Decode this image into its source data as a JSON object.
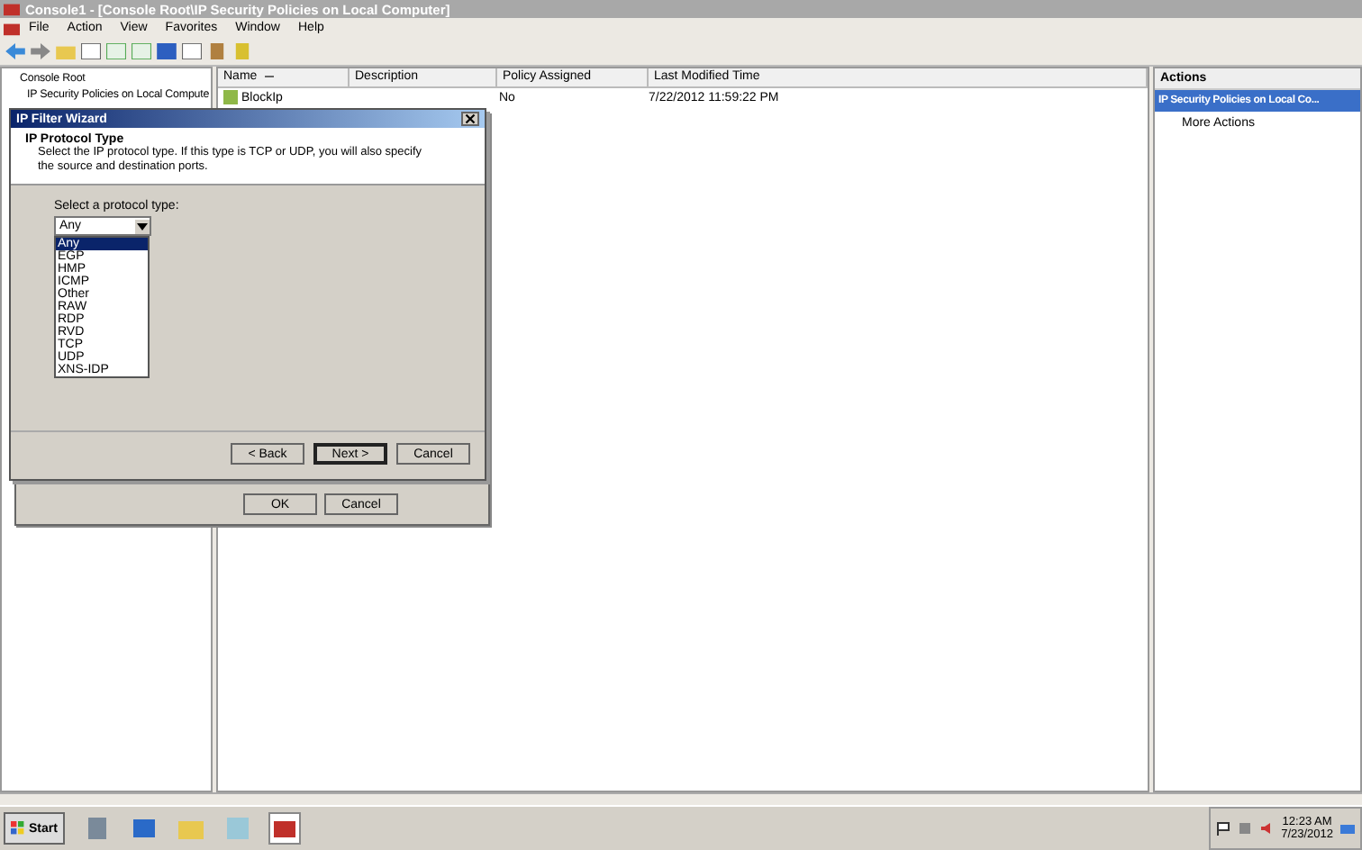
{
  "window": {
    "title": "Console1 - [Console Root\\IP Security Policies on Local Computer]"
  },
  "menu": [
    "File",
    "Action",
    "View",
    "Favorites",
    "Window",
    "Help"
  ],
  "tree": {
    "items": [
      {
        "label": "Console Root",
        "children": [
          {
            "label": "IP Security Policies on Local Compute"
          }
        ]
      }
    ]
  },
  "list": {
    "columns": [
      {
        "label": "Name",
        "sorted": true
      },
      {
        "label": "Description",
        "sorted": false
      },
      {
        "label": "Policy Assigned",
        "sorted": false
      },
      {
        "label": "Last Modified Time",
        "sorted": false
      }
    ],
    "rows": [
      {
        "name": "BlockIp",
        "policy_assigned": "No",
        "last_modified": "7/22/2012 11:59:22 PM"
      }
    ]
  },
  "actions": {
    "title": "Actions",
    "section": "IP Security Policies on Local Co...",
    "items": [
      "More Actions"
    ]
  },
  "background_dialog": {
    "buttons": [
      "OK",
      "Cancel"
    ]
  },
  "wizard": {
    "title": "IP Filter Wizard",
    "heading": "IP Protocol Type",
    "description": "Select the IP protocol type. If this type is TCP or UDP, you will also specify the source and destination ports.",
    "field_label": "Select a protocol type:",
    "combo_value": "Any",
    "options": [
      {
        "label": "Any",
        "selected": true
      },
      {
        "label": "EGP",
        "selected": false
      },
      {
        "label": "HMP",
        "selected": false
      },
      {
        "label": "ICMP",
        "selected": false
      },
      {
        "label": "Other",
        "selected": false
      },
      {
        "label": "RAW",
        "selected": false
      },
      {
        "label": "RDP",
        "selected": false
      },
      {
        "label": "RVD",
        "selected": false
      },
      {
        "label": "TCP",
        "selected": false
      },
      {
        "label": "UDP",
        "selected": false
      },
      {
        "label": "XNS-IDP",
        "selected": false
      }
    ],
    "buttons": [
      {
        "label": "< Back",
        "default": false
      },
      {
        "label": "Next >",
        "default": true
      },
      {
        "label": "Cancel",
        "default": false
      }
    ]
  },
  "taskbar": {
    "start": "Start",
    "time": "12:23 AM",
    "date": "7/23/2012"
  }
}
